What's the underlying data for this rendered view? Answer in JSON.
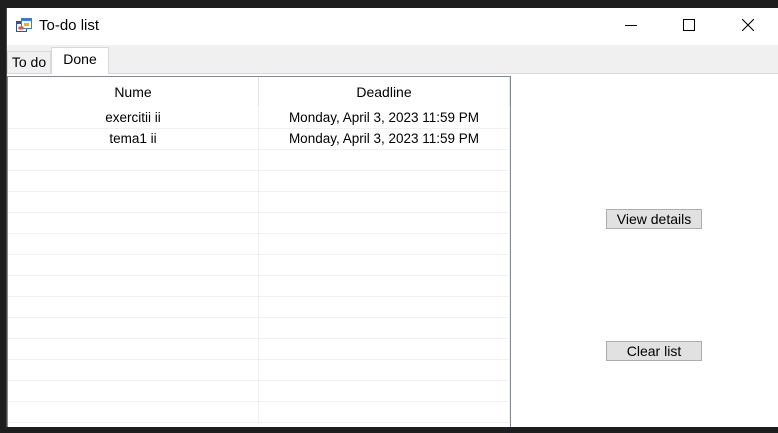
{
  "window": {
    "title": "To-do list",
    "icon": "app-form-icon",
    "controls": {
      "minimize": "minimize-icon",
      "maximize": "maximize-icon",
      "close": "close-icon"
    }
  },
  "tabs": [
    {
      "label": "To do",
      "selected": false
    },
    {
      "label": "Done",
      "selected": true
    }
  ],
  "grid": {
    "columns": [
      "Nume",
      "Deadline"
    ],
    "rows": [
      {
        "name": "exercitii ii",
        "deadline": "Monday, April 3, 2023 11:59 PM"
      },
      {
        "name": "tema1 ii",
        "deadline": "Monday, April 3, 2023 11:59 PM"
      }
    ],
    "empty_rows": 13
  },
  "buttons": {
    "view_details": "View details",
    "clear_list": "Clear list"
  },
  "colors": {
    "button_bg": "#e1e1e1",
    "button_border": "#adadad",
    "grid_border": "#828790",
    "client_bg": "#f0f0f0"
  }
}
